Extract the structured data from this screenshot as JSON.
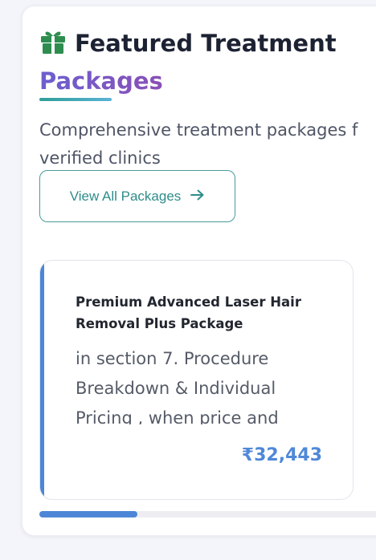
{
  "section": {
    "title_line1": "Featured Treatment",
    "title_line2": "Packages",
    "subtitle_line1": "Comprehensive treatment packages f",
    "subtitle_line2": "verified clinics",
    "gift_icon": "gift-icon",
    "view_all_label": "View All Packages",
    "view_all_icon": "arrow-right-icon"
  },
  "package_card": {
    "title": "Premium Advanced Laser Hair Removal Plus Package",
    "description": "in section 7. Procedure Breakdown & Individual Pricing , when price and",
    "price": "₹32,443"
  },
  "carousel": {
    "scroll_position": 0.26
  },
  "colors": {
    "accent_blue": "#4d86d6",
    "teal": "#2e8d8a",
    "gift_green": "#2e8d4e",
    "purple_gradient_start": "#6c5fd0",
    "purple_gradient_end": "#8a4fb6"
  }
}
